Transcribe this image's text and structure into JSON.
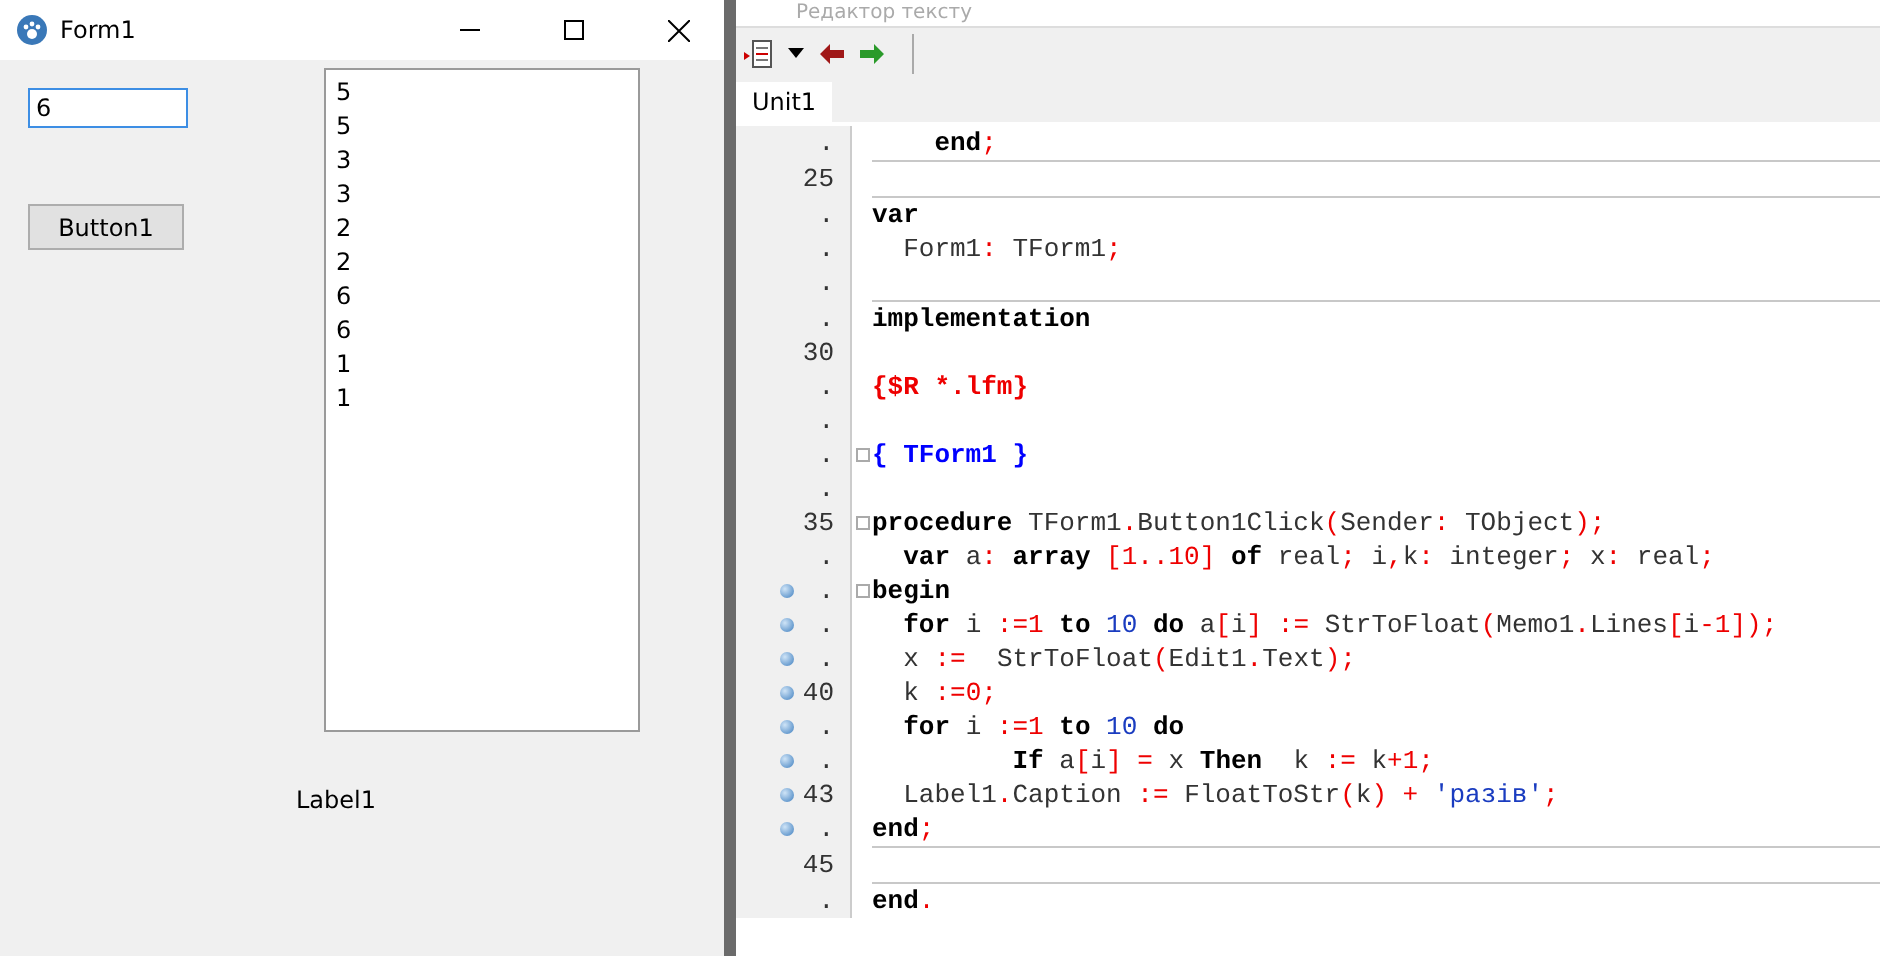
{
  "form_window": {
    "title": "Form1",
    "edit": {
      "value": "6",
      "focused": true
    },
    "button": "Button1",
    "memo_lines": [
      "5",
      "5",
      "3",
      "3",
      "2",
      "2",
      "6",
      "6",
      "1",
      "1"
    ],
    "label": "Label1"
  },
  "editor": {
    "title": "Редактор тексту",
    "tabs": [
      {
        "label": "Unit1",
        "selected": true
      }
    ],
    "lines": [
      {
        "num": ".",
        "breakpoint": false,
        "fold": false,
        "separator": true,
        "code": [
          {
            "t": "    end",
            "kind": "kw"
          },
          {
            "t": ";",
            "kind": "sym"
          }
        ]
      },
      {
        "num": "25",
        "breakpoint": false,
        "fold": false,
        "separator": true
      },
      {
        "num": ".",
        "breakpoint": false,
        "fold": false,
        "separator": false,
        "code": [
          {
            "t": "var",
            "kind": "kw"
          }
        ]
      },
      {
        "num": ".",
        "breakpoint": false,
        "fold": false,
        "separator": false,
        "code": [
          {
            "t": "  Form1",
            "kind": "plain"
          },
          {
            "t": ": ",
            "kind": "sym"
          },
          {
            "t": "TForm1",
            "kind": "plain"
          },
          {
            "t": ";",
            "kind": "sym"
          }
        ]
      },
      {
        "num": ".",
        "breakpoint": false,
        "fold": false,
        "separator": true
      },
      {
        "num": ".",
        "breakpoint": false,
        "fold": false,
        "separator": false,
        "code": [
          {
            "t": "implementation",
            "kind": "kw"
          }
        ]
      },
      {
        "num": "30",
        "breakpoint": false,
        "fold": false,
        "separator": false
      },
      {
        "num": ".",
        "breakpoint": false,
        "fold": false,
        "separator": false,
        "code": [
          {
            "t": "{$R *.lfm}",
            "kind": "dir"
          }
        ]
      },
      {
        "num": ".",
        "breakpoint": false,
        "fold": false,
        "separator": false
      },
      {
        "num": ".",
        "breakpoint": false,
        "fold": true,
        "separator": false,
        "code": [
          {
            "t": "{ TForm1 }",
            "kind": "comment"
          }
        ]
      },
      {
        "num": ".",
        "breakpoint": false,
        "fold": false,
        "separator": false
      },
      {
        "num": "35",
        "breakpoint": false,
        "fold": true,
        "separator": false,
        "code": [
          {
            "t": "procedure ",
            "kind": "kw"
          },
          {
            "t": "TForm1",
            "kind": "plain"
          },
          {
            "t": ".",
            "kind": "sym"
          },
          {
            "t": "Button1Click",
            "kind": "plain"
          },
          {
            "t": "(",
            "kind": "sym"
          },
          {
            "t": "Sender",
            "kind": "plain"
          },
          {
            "t": ": ",
            "kind": "sym"
          },
          {
            "t": "TObject",
            "kind": "plain"
          },
          {
            "t": ");",
            "kind": "sym"
          }
        ]
      },
      {
        "num": ".",
        "breakpoint": false,
        "fold": false,
        "separator": false,
        "code": [
          {
            "t": "  var ",
            "kind": "kw"
          },
          {
            "t": "a",
            "kind": "plain"
          },
          {
            "t": ": ",
            "kind": "sym"
          },
          {
            "t": "array ",
            "kind": "kw"
          },
          {
            "t": "[1..10] ",
            "kind": "sym"
          },
          {
            "t": "of ",
            "kind": "kw"
          },
          {
            "t": "real",
            "kind": "plain"
          },
          {
            "t": "; ",
            "kind": "sym"
          },
          {
            "t": "i",
            "kind": "plain"
          },
          {
            "t": ",",
            "kind": "sym"
          },
          {
            "t": "k",
            "kind": "plain"
          },
          {
            "t": ": ",
            "kind": "sym"
          },
          {
            "t": "integer",
            "kind": "plain"
          },
          {
            "t": "; ",
            "kind": "sym"
          },
          {
            "t": "x",
            "kind": "plain"
          },
          {
            "t": ": ",
            "kind": "sym"
          },
          {
            "t": "real",
            "kind": "plain"
          },
          {
            "t": ";",
            "kind": "sym"
          }
        ]
      },
      {
        "num": ".",
        "breakpoint": true,
        "fold": true,
        "separator": false,
        "code": [
          {
            "t": "begin",
            "kind": "kw"
          }
        ]
      },
      {
        "num": ".",
        "breakpoint": true,
        "fold": false,
        "separator": false,
        "code": [
          {
            "t": "  for ",
            "kind": "kw"
          },
          {
            "t": "i ",
            "kind": "plain"
          },
          {
            "t": ":=1 ",
            "kind": "sym"
          },
          {
            "t": "to ",
            "kind": "kw"
          },
          {
            "t": "10 ",
            "kind": "num"
          },
          {
            "t": "do ",
            "kind": "kw"
          },
          {
            "t": "a",
            "kind": "plain"
          },
          {
            "t": "[",
            "kind": "sym"
          },
          {
            "t": "i",
            "kind": "plain"
          },
          {
            "t": "] := ",
            "kind": "sym"
          },
          {
            "t": "StrToFloat",
            "kind": "plain"
          },
          {
            "t": "(",
            "kind": "sym"
          },
          {
            "t": "Memo1",
            "kind": "plain"
          },
          {
            "t": ".",
            "kind": "sym"
          },
          {
            "t": "Lines",
            "kind": "plain"
          },
          {
            "t": "[",
            "kind": "sym"
          },
          {
            "t": "i",
            "kind": "plain"
          },
          {
            "t": "-1]);",
            "kind": "sym"
          }
        ]
      },
      {
        "num": ".",
        "breakpoint": true,
        "fold": false,
        "separator": false,
        "code": [
          {
            "t": "  x ",
            "kind": "plain"
          },
          {
            "t": ":=  ",
            "kind": "sym"
          },
          {
            "t": "StrToFloat",
            "kind": "plain"
          },
          {
            "t": "(",
            "kind": "sym"
          },
          {
            "t": "Edit1",
            "kind": "plain"
          },
          {
            "t": ".",
            "kind": "sym"
          },
          {
            "t": "Text",
            "kind": "plain"
          },
          {
            "t": ");",
            "kind": "sym"
          }
        ]
      },
      {
        "num": "40",
        "breakpoint": true,
        "fold": false,
        "separator": false,
        "code": [
          {
            "t": "  k ",
            "kind": "plain"
          },
          {
            "t": ":=0;",
            "kind": "sym"
          }
        ]
      },
      {
        "num": ".",
        "breakpoint": true,
        "fold": false,
        "separator": false,
        "code": [
          {
            "t": "  for ",
            "kind": "kw"
          },
          {
            "t": "i ",
            "kind": "plain"
          },
          {
            "t": ":=1 ",
            "kind": "sym"
          },
          {
            "t": "to ",
            "kind": "kw"
          },
          {
            "t": "10 ",
            "kind": "num"
          },
          {
            "t": "do",
            "kind": "kw"
          }
        ]
      },
      {
        "num": ".",
        "breakpoint": true,
        "fold": false,
        "separator": false,
        "code": [
          {
            "t": "         If ",
            "kind": "kw"
          },
          {
            "t": "a",
            "kind": "plain"
          },
          {
            "t": "[",
            "kind": "sym"
          },
          {
            "t": "i",
            "kind": "plain"
          },
          {
            "t": "] = ",
            "kind": "sym"
          },
          {
            "t": "x ",
            "kind": "plain"
          },
          {
            "t": "Then  ",
            "kind": "kw"
          },
          {
            "t": "k ",
            "kind": "plain"
          },
          {
            "t": ":= ",
            "kind": "sym"
          },
          {
            "t": "k",
            "kind": "plain"
          },
          {
            "t": "+1;",
            "kind": "sym"
          }
        ]
      },
      {
        "num": "43",
        "breakpoint": true,
        "fold": false,
        "separator": false,
        "code": [
          {
            "t": "  Label1",
            "kind": "plain"
          },
          {
            "t": ".",
            "kind": "sym"
          },
          {
            "t": "Caption ",
            "kind": "plain"
          },
          {
            "t": ":= ",
            "kind": "sym"
          },
          {
            "t": "FloatToStr",
            "kind": "plain"
          },
          {
            "t": "(",
            "kind": "sym"
          },
          {
            "t": "k",
            "kind": "plain"
          },
          {
            "t": ") + ",
            "kind": "sym"
          },
          {
            "t": "'разів'",
            "kind": "str"
          },
          {
            "t": ";",
            "kind": "sym"
          }
        ]
      },
      {
        "num": ".",
        "breakpoint": true,
        "fold": false,
        "separator": true,
        "code": [
          {
            "t": "end",
            "kind": "kw"
          },
          {
            "t": ";",
            "kind": "sym"
          }
        ]
      },
      {
        "num": "45",
        "breakpoint": false,
        "fold": false,
        "separator": true
      },
      {
        "num": ".",
        "breakpoint": false,
        "fold": false,
        "separator": false,
        "code": [
          {
            "t": "end",
            "kind": "kw"
          },
          {
            "t": ".",
            "kind": "sym"
          }
        ]
      }
    ]
  }
}
